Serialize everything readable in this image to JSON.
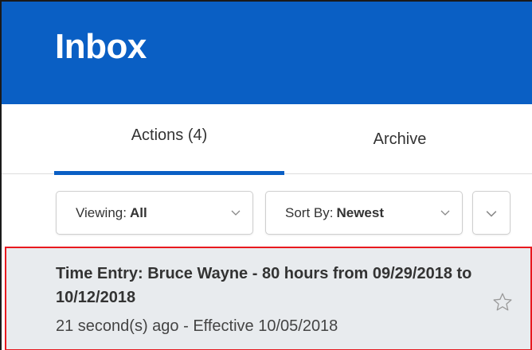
{
  "header": {
    "title": "Inbox",
    "background": "#0a5fc4"
  },
  "tabs": [
    {
      "label": "Actions (4)",
      "active": true
    },
    {
      "label": "Archive",
      "active": false
    }
  ],
  "filters": {
    "viewing": {
      "label": "Viewing:",
      "value": "All"
    },
    "sort": {
      "label": "Sort By:",
      "value": "Newest"
    },
    "more_icon": "chevron-down-icon"
  },
  "item": {
    "title": "Time Entry: Bruce Wayne - 80 hours from 09/29/2018 to 10/12/2018",
    "meta": "21 second(s) ago - Effective 10/05/2018",
    "star_icon": "star-outline-icon",
    "highlight_color": "#e8191f"
  }
}
